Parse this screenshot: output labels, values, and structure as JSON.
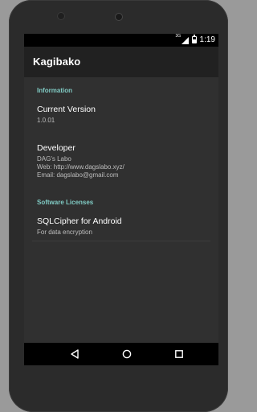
{
  "device": {
    "status_bar": {
      "network_label": "3G",
      "time": "1:19",
      "icons": [
        "signal-icon",
        "battery-icon"
      ]
    },
    "nav_bar": {
      "icons": [
        "back-icon",
        "home-icon",
        "recents-icon"
      ]
    }
  },
  "app": {
    "title": "Kagibako"
  },
  "sections": {
    "information": {
      "header": "Information",
      "current_version": {
        "title": "Current Version",
        "summary": "1.0.01"
      },
      "developer": {
        "title": "Developer",
        "name": "DAG's Labo",
        "web": "Web: http://www.dagslabo.xyz/",
        "email": "Email: dagslabo@gmail.com"
      }
    },
    "licenses": {
      "header": "Software Licenses",
      "sqlcipher": {
        "title": "SQLCipher for Android",
        "summary": "For data encryption"
      }
    }
  },
  "colors": {
    "accent": "#80cbc4",
    "app_bar": "#212121",
    "background": "#303030"
  }
}
